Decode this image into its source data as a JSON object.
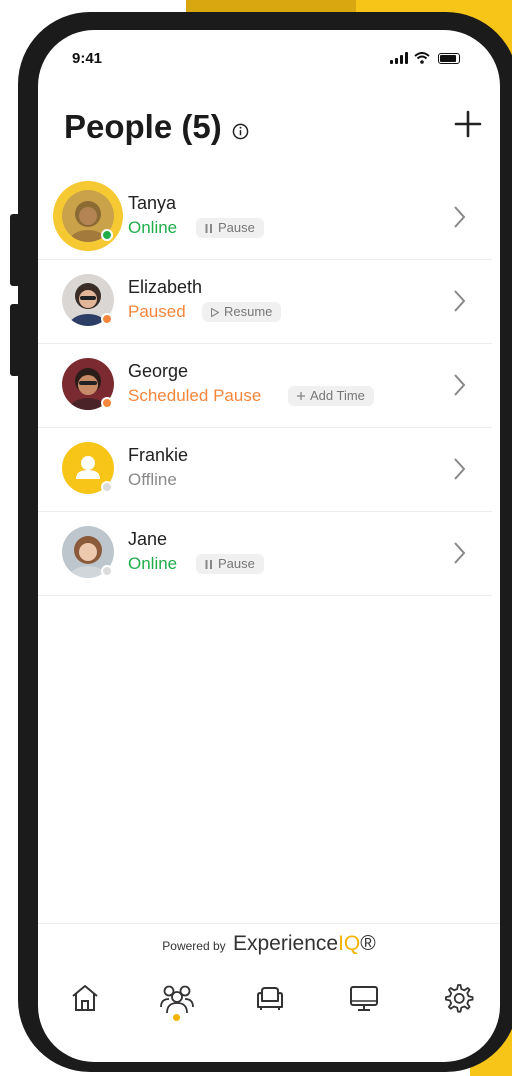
{
  "status_bar": {
    "time": "9:41"
  },
  "header": {
    "title": "People (5)"
  },
  "colors": {
    "online": "#1fad4b",
    "paused": "#f5863c",
    "offline": "#8a8a8a",
    "accent": "#f4b400"
  },
  "people": [
    {
      "name": "Tanya",
      "status": "Online",
      "action_label": "Pause",
      "action_icon": "pause-icon",
      "avatar_icon": "photo-avatar"
    },
    {
      "name": "Elizabeth",
      "status": "Paused",
      "action_label": "Resume",
      "action_icon": "play-icon",
      "avatar_icon": "photo-avatar"
    },
    {
      "name": "George",
      "status": "Scheduled Pause",
      "action_label": "Add Time",
      "action_icon": "plus-icon",
      "avatar_icon": "photo-avatar"
    },
    {
      "name": "Frankie",
      "status": "Offline",
      "action_label": "",
      "action_icon": "",
      "avatar_icon": "user-placeholder-icon"
    },
    {
      "name": "Jane",
      "status": "Online",
      "action_label": "Pause",
      "action_icon": "pause-icon",
      "avatar_icon": "photo-avatar"
    }
  ],
  "footer": {
    "powered_by": "Powered by",
    "brand_main": "Experience",
    "brand_accent": "IQ",
    "brand_suffix": "®"
  },
  "tabs": [
    {
      "icon": "home-icon"
    },
    {
      "icon": "people-icon",
      "active": true
    },
    {
      "icon": "couch-icon"
    },
    {
      "icon": "monitor-icon"
    },
    {
      "icon": "gear-icon"
    }
  ]
}
